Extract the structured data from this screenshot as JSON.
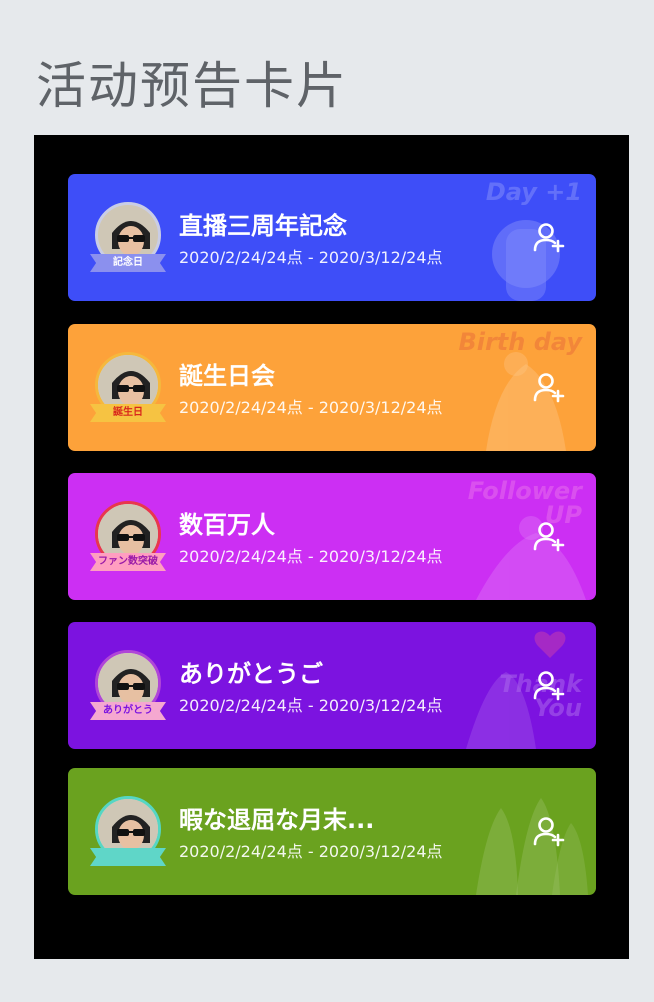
{
  "page": {
    "title": "活动预告卡片"
  },
  "cards": [
    {
      "title": "直播三周年記念",
      "dates": "2020/2/24/24点 - 2020/3/12/24点",
      "badge": "記念日",
      "deco_text": "Day +1",
      "colors": {
        "bg": "#3e4ef8",
        "ring": "#c9cde6",
        "ribbon": "#8b90ee",
        "ribbon_text": "#ffffff"
      }
    },
    {
      "title": "誕生日会",
      "dates": "2020/2/24/24点 - 2020/3/12/24点",
      "badge": "誕生日",
      "deco_text": "Birth day",
      "colors": {
        "bg": "#fda23a",
        "ring": "#f5b83d",
        "ribbon": "#f6c342",
        "ribbon_text": "#d8261c"
      }
    },
    {
      "title": "数百万人",
      "dates": "2020/2/24/24点 - 2020/3/12/24点",
      "badge": "ファン数突破",
      "deco_text": "Follower UP",
      "colors": {
        "bg": "#cc2ff3",
        "ring": "#e8374d",
        "ribbon": "#ff9ec0",
        "ribbon_text": "#9b1aa8"
      }
    },
    {
      "title": "ありがとうご",
      "dates": "2020/2/24/24点 - 2020/3/12/24点",
      "badge": "ありがとう",
      "deco_text": "Thank You",
      "colors": {
        "bg": "#7c13e0",
        "ring": "#b046d8",
        "ribbon": "#f5a8d0",
        "ribbon_text": "#7c13e0"
      }
    },
    {
      "title": "暇な退屈な月末...",
      "dates": "2020/2/24/24点 - 2020/3/12/24点",
      "badge": "",
      "deco_text": "",
      "colors": {
        "bg": "#6aa21f",
        "ring": "#56d6c4",
        "ribbon": "#5fd6c8",
        "ribbon_text": "#ffffff"
      }
    }
  ],
  "icons": {
    "follow": "user-plus-icon",
    "avatar": "avatar-person"
  }
}
